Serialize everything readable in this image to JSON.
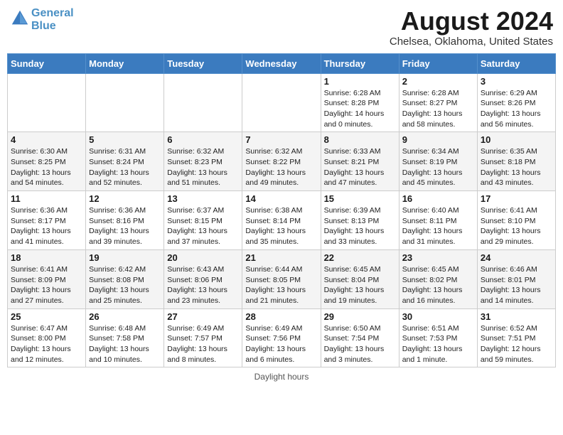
{
  "header": {
    "logo_line1": "General",
    "logo_line2": "Blue",
    "main_title": "August 2024",
    "subtitle": "Chelsea, Oklahoma, United States"
  },
  "weekdays": [
    "Sunday",
    "Monday",
    "Tuesday",
    "Wednesday",
    "Thursday",
    "Friday",
    "Saturday"
  ],
  "footer": "Daylight hours",
  "weeks": [
    [
      {
        "day": "",
        "info": ""
      },
      {
        "day": "",
        "info": ""
      },
      {
        "day": "",
        "info": ""
      },
      {
        "day": "",
        "info": ""
      },
      {
        "day": "1",
        "info": "Sunrise: 6:28 AM\nSunset: 8:28 PM\nDaylight: 14 hours\nand 0 minutes."
      },
      {
        "day": "2",
        "info": "Sunrise: 6:28 AM\nSunset: 8:27 PM\nDaylight: 13 hours\nand 58 minutes."
      },
      {
        "day": "3",
        "info": "Sunrise: 6:29 AM\nSunset: 8:26 PM\nDaylight: 13 hours\nand 56 minutes."
      }
    ],
    [
      {
        "day": "4",
        "info": "Sunrise: 6:30 AM\nSunset: 8:25 PM\nDaylight: 13 hours\nand 54 minutes."
      },
      {
        "day": "5",
        "info": "Sunrise: 6:31 AM\nSunset: 8:24 PM\nDaylight: 13 hours\nand 52 minutes."
      },
      {
        "day": "6",
        "info": "Sunrise: 6:32 AM\nSunset: 8:23 PM\nDaylight: 13 hours\nand 51 minutes."
      },
      {
        "day": "7",
        "info": "Sunrise: 6:32 AM\nSunset: 8:22 PM\nDaylight: 13 hours\nand 49 minutes."
      },
      {
        "day": "8",
        "info": "Sunrise: 6:33 AM\nSunset: 8:21 PM\nDaylight: 13 hours\nand 47 minutes."
      },
      {
        "day": "9",
        "info": "Sunrise: 6:34 AM\nSunset: 8:19 PM\nDaylight: 13 hours\nand 45 minutes."
      },
      {
        "day": "10",
        "info": "Sunrise: 6:35 AM\nSunset: 8:18 PM\nDaylight: 13 hours\nand 43 minutes."
      }
    ],
    [
      {
        "day": "11",
        "info": "Sunrise: 6:36 AM\nSunset: 8:17 PM\nDaylight: 13 hours\nand 41 minutes."
      },
      {
        "day": "12",
        "info": "Sunrise: 6:36 AM\nSunset: 8:16 PM\nDaylight: 13 hours\nand 39 minutes."
      },
      {
        "day": "13",
        "info": "Sunrise: 6:37 AM\nSunset: 8:15 PM\nDaylight: 13 hours\nand 37 minutes."
      },
      {
        "day": "14",
        "info": "Sunrise: 6:38 AM\nSunset: 8:14 PM\nDaylight: 13 hours\nand 35 minutes."
      },
      {
        "day": "15",
        "info": "Sunrise: 6:39 AM\nSunset: 8:13 PM\nDaylight: 13 hours\nand 33 minutes."
      },
      {
        "day": "16",
        "info": "Sunrise: 6:40 AM\nSunset: 8:11 PM\nDaylight: 13 hours\nand 31 minutes."
      },
      {
        "day": "17",
        "info": "Sunrise: 6:41 AM\nSunset: 8:10 PM\nDaylight: 13 hours\nand 29 minutes."
      }
    ],
    [
      {
        "day": "18",
        "info": "Sunrise: 6:41 AM\nSunset: 8:09 PM\nDaylight: 13 hours\nand 27 minutes."
      },
      {
        "day": "19",
        "info": "Sunrise: 6:42 AM\nSunset: 8:08 PM\nDaylight: 13 hours\nand 25 minutes."
      },
      {
        "day": "20",
        "info": "Sunrise: 6:43 AM\nSunset: 8:06 PM\nDaylight: 13 hours\nand 23 minutes."
      },
      {
        "day": "21",
        "info": "Sunrise: 6:44 AM\nSunset: 8:05 PM\nDaylight: 13 hours\nand 21 minutes."
      },
      {
        "day": "22",
        "info": "Sunrise: 6:45 AM\nSunset: 8:04 PM\nDaylight: 13 hours\nand 19 minutes."
      },
      {
        "day": "23",
        "info": "Sunrise: 6:45 AM\nSunset: 8:02 PM\nDaylight: 13 hours\nand 16 minutes."
      },
      {
        "day": "24",
        "info": "Sunrise: 6:46 AM\nSunset: 8:01 PM\nDaylight: 13 hours\nand 14 minutes."
      }
    ],
    [
      {
        "day": "25",
        "info": "Sunrise: 6:47 AM\nSunset: 8:00 PM\nDaylight: 13 hours\nand 12 minutes."
      },
      {
        "day": "26",
        "info": "Sunrise: 6:48 AM\nSunset: 7:58 PM\nDaylight: 13 hours\nand 10 minutes."
      },
      {
        "day": "27",
        "info": "Sunrise: 6:49 AM\nSunset: 7:57 PM\nDaylight: 13 hours\nand 8 minutes."
      },
      {
        "day": "28",
        "info": "Sunrise: 6:49 AM\nSunset: 7:56 PM\nDaylight: 13 hours\nand 6 minutes."
      },
      {
        "day": "29",
        "info": "Sunrise: 6:50 AM\nSunset: 7:54 PM\nDaylight: 13 hours\nand 3 minutes."
      },
      {
        "day": "30",
        "info": "Sunrise: 6:51 AM\nSunset: 7:53 PM\nDaylight: 13 hours\nand 1 minute."
      },
      {
        "day": "31",
        "info": "Sunrise: 6:52 AM\nSunset: 7:51 PM\nDaylight: 12 hours\nand 59 minutes."
      }
    ]
  ]
}
